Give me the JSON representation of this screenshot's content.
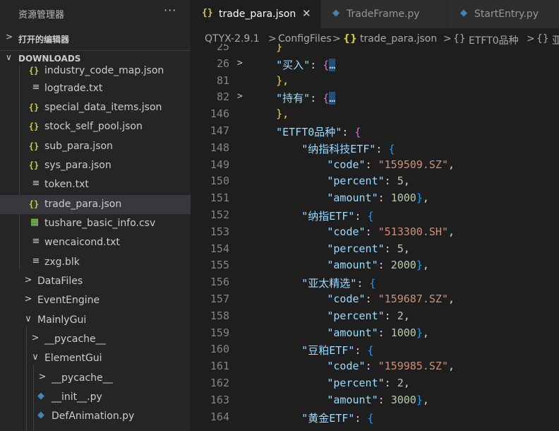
{
  "sidebar": {
    "title": "资源管理器",
    "more_icon": "···",
    "open_editors_label": "打开的编辑器",
    "downloads_label": "DOWNLOADS",
    "files": [
      {
        "name": "industry_code_map.json",
        "icon": "{}"
      },
      {
        "name": "logtrade.txt",
        "icon": "≡"
      },
      {
        "name": "special_data_items.json",
        "icon": "{}"
      },
      {
        "name": "stock_self_pool.json",
        "icon": "{}"
      },
      {
        "name": "sub_para.json",
        "icon": "{}"
      },
      {
        "name": "sys_para.json",
        "icon": "{}"
      },
      {
        "name": "token.txt",
        "icon": "≡"
      },
      {
        "name": "trade_para.json",
        "icon": "{}"
      },
      {
        "name": "tushare_basic_info.csv",
        "icon": "▦"
      },
      {
        "name": "wencaicond.txt",
        "icon": "≡"
      },
      {
        "name": "zxg.blk",
        "icon": "≡"
      }
    ],
    "folders": [
      {
        "name": "DataFiles",
        "icon": ">"
      },
      {
        "name": "EventEngine",
        "icon": ">"
      },
      {
        "name": "MainlyGui",
        "icon": "∨"
      },
      {
        "name": "__pycache__",
        "icon": ">"
      },
      {
        "name": "ElementGui",
        "icon": "∨"
      },
      {
        "name": "__pycache__",
        "icon": ">"
      },
      {
        "name": "__init__.py",
        "icon": "◆"
      },
      {
        "name": "DefAnimation.py",
        "icon": "◆"
      }
    ]
  },
  "tabs": [
    {
      "label": "trade_para.json",
      "icon": "{}",
      "close": "✕"
    },
    {
      "label": "TradeFrame.py",
      "icon": "◆"
    },
    {
      "label": "StartEntry.py",
      "icon": "◆"
    }
  ],
  "breadcrumbs": [
    "QTYX-2.9.1",
    ">",
    "ConfigFiles",
    ">",
    "{}",
    "trade_para.json",
    ">",
    "{}",
    "ETFT0品种",
    ">",
    "{}",
    "亚"
  ],
  "code": {
    "lines": [
      {
        "n": "25",
        "t": "}"
      },
      {
        "n": "26",
        "key": "买入",
        "fold": ">"
      },
      {
        "n": "81",
        "t": "},"
      },
      {
        "n": "82",
        "key": "持有",
        "fold": ">"
      },
      {
        "n": "146",
        "t": "},"
      },
      {
        "n": "147",
        "key": "ETFT0品种"
      },
      {
        "n": "148",
        "key": "纳指科技ETF"
      },
      {
        "n": "149",
        "key": "code",
        "val": "159509.SZ"
      },
      {
        "n": "150",
        "key": "percent",
        "num": "5"
      },
      {
        "n": "151",
        "key": "amount",
        "num": "1000"
      },
      {
        "n": "152",
        "key": "纳指ETF"
      },
      {
        "n": "153",
        "key": "code",
        "val": "513300.SH"
      },
      {
        "n": "154",
        "key": "percent",
        "num": "5"
      },
      {
        "n": "155",
        "key": "amount",
        "num": "2000"
      },
      {
        "n": "156",
        "key": "亚太精选"
      },
      {
        "n": "157",
        "key": "code",
        "val": "159687.SZ"
      },
      {
        "n": "158",
        "key": "percent",
        "num": "2"
      },
      {
        "n": "159",
        "key": "amount",
        "num": "1000"
      },
      {
        "n": "160",
        "key": "豆粕ETF"
      },
      {
        "n": "161",
        "key": "code",
        "val": "159985.SZ"
      },
      {
        "n": "162",
        "key": "percent",
        "num": "2"
      },
      {
        "n": "163",
        "key": "amount",
        "num": "3000"
      },
      {
        "n": "164",
        "key": "黄金ETF"
      }
    ],
    "folded_marker": "…"
  },
  "colors": {
    "key": "#9cdcfe",
    "string": "#ce9178",
    "number": "#b5cea8",
    "json_icon": "#cbcb41",
    "py_icon": "#4584b6"
  }
}
